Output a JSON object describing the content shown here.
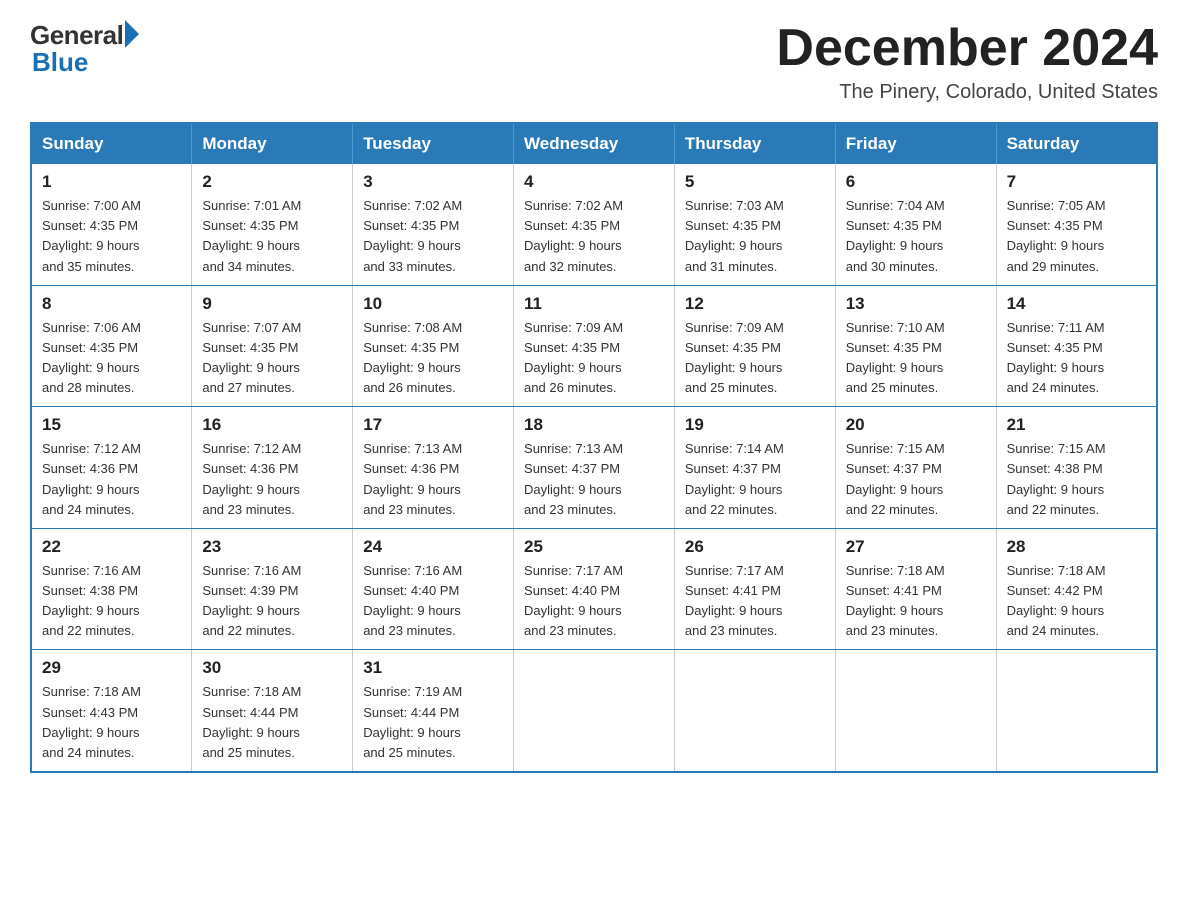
{
  "logo": {
    "text_general": "General",
    "text_blue": "Blue"
  },
  "header": {
    "month_title": "December 2024",
    "location": "The Pinery, Colorado, United States"
  },
  "weekdays": [
    "Sunday",
    "Monday",
    "Tuesday",
    "Wednesday",
    "Thursday",
    "Friday",
    "Saturday"
  ],
  "weeks": [
    [
      {
        "day": "1",
        "sunrise": "7:00 AM",
        "sunset": "4:35 PM",
        "daylight": "9 hours and 35 minutes."
      },
      {
        "day": "2",
        "sunrise": "7:01 AM",
        "sunset": "4:35 PM",
        "daylight": "9 hours and 34 minutes."
      },
      {
        "day": "3",
        "sunrise": "7:02 AM",
        "sunset": "4:35 PM",
        "daylight": "9 hours and 33 minutes."
      },
      {
        "day": "4",
        "sunrise": "7:02 AM",
        "sunset": "4:35 PM",
        "daylight": "9 hours and 32 minutes."
      },
      {
        "day": "5",
        "sunrise": "7:03 AM",
        "sunset": "4:35 PM",
        "daylight": "9 hours and 31 minutes."
      },
      {
        "day": "6",
        "sunrise": "7:04 AM",
        "sunset": "4:35 PM",
        "daylight": "9 hours and 30 minutes."
      },
      {
        "day": "7",
        "sunrise": "7:05 AM",
        "sunset": "4:35 PM",
        "daylight": "9 hours and 29 minutes."
      }
    ],
    [
      {
        "day": "8",
        "sunrise": "7:06 AM",
        "sunset": "4:35 PM",
        "daylight": "9 hours and 28 minutes."
      },
      {
        "day": "9",
        "sunrise": "7:07 AM",
        "sunset": "4:35 PM",
        "daylight": "9 hours and 27 minutes."
      },
      {
        "day": "10",
        "sunrise": "7:08 AM",
        "sunset": "4:35 PM",
        "daylight": "9 hours and 26 minutes."
      },
      {
        "day": "11",
        "sunrise": "7:09 AM",
        "sunset": "4:35 PM",
        "daylight": "9 hours and 26 minutes."
      },
      {
        "day": "12",
        "sunrise": "7:09 AM",
        "sunset": "4:35 PM",
        "daylight": "9 hours and 25 minutes."
      },
      {
        "day": "13",
        "sunrise": "7:10 AM",
        "sunset": "4:35 PM",
        "daylight": "9 hours and 25 minutes."
      },
      {
        "day": "14",
        "sunrise": "7:11 AM",
        "sunset": "4:35 PM",
        "daylight": "9 hours and 24 minutes."
      }
    ],
    [
      {
        "day": "15",
        "sunrise": "7:12 AM",
        "sunset": "4:36 PM",
        "daylight": "9 hours and 24 minutes."
      },
      {
        "day": "16",
        "sunrise": "7:12 AM",
        "sunset": "4:36 PM",
        "daylight": "9 hours and 23 minutes."
      },
      {
        "day": "17",
        "sunrise": "7:13 AM",
        "sunset": "4:36 PM",
        "daylight": "9 hours and 23 minutes."
      },
      {
        "day": "18",
        "sunrise": "7:13 AM",
        "sunset": "4:37 PM",
        "daylight": "9 hours and 23 minutes."
      },
      {
        "day": "19",
        "sunrise": "7:14 AM",
        "sunset": "4:37 PM",
        "daylight": "9 hours and 22 minutes."
      },
      {
        "day": "20",
        "sunrise": "7:15 AM",
        "sunset": "4:37 PM",
        "daylight": "9 hours and 22 minutes."
      },
      {
        "day": "21",
        "sunrise": "7:15 AM",
        "sunset": "4:38 PM",
        "daylight": "9 hours and 22 minutes."
      }
    ],
    [
      {
        "day": "22",
        "sunrise": "7:16 AM",
        "sunset": "4:38 PM",
        "daylight": "9 hours and 22 minutes."
      },
      {
        "day": "23",
        "sunrise": "7:16 AM",
        "sunset": "4:39 PM",
        "daylight": "9 hours and 22 minutes."
      },
      {
        "day": "24",
        "sunrise": "7:16 AM",
        "sunset": "4:40 PM",
        "daylight": "9 hours and 23 minutes."
      },
      {
        "day": "25",
        "sunrise": "7:17 AM",
        "sunset": "4:40 PM",
        "daylight": "9 hours and 23 minutes."
      },
      {
        "day": "26",
        "sunrise": "7:17 AM",
        "sunset": "4:41 PM",
        "daylight": "9 hours and 23 minutes."
      },
      {
        "day": "27",
        "sunrise": "7:18 AM",
        "sunset": "4:41 PM",
        "daylight": "9 hours and 23 minutes."
      },
      {
        "day": "28",
        "sunrise": "7:18 AM",
        "sunset": "4:42 PM",
        "daylight": "9 hours and 24 minutes."
      }
    ],
    [
      {
        "day": "29",
        "sunrise": "7:18 AM",
        "sunset": "4:43 PM",
        "daylight": "9 hours and 24 minutes."
      },
      {
        "day": "30",
        "sunrise": "7:18 AM",
        "sunset": "4:44 PM",
        "daylight": "9 hours and 25 minutes."
      },
      {
        "day": "31",
        "sunrise": "7:19 AM",
        "sunset": "4:44 PM",
        "daylight": "9 hours and 25 minutes."
      },
      null,
      null,
      null,
      null
    ]
  ],
  "labels": {
    "sunrise": "Sunrise:",
    "sunset": "Sunset:",
    "daylight": "Daylight:"
  }
}
